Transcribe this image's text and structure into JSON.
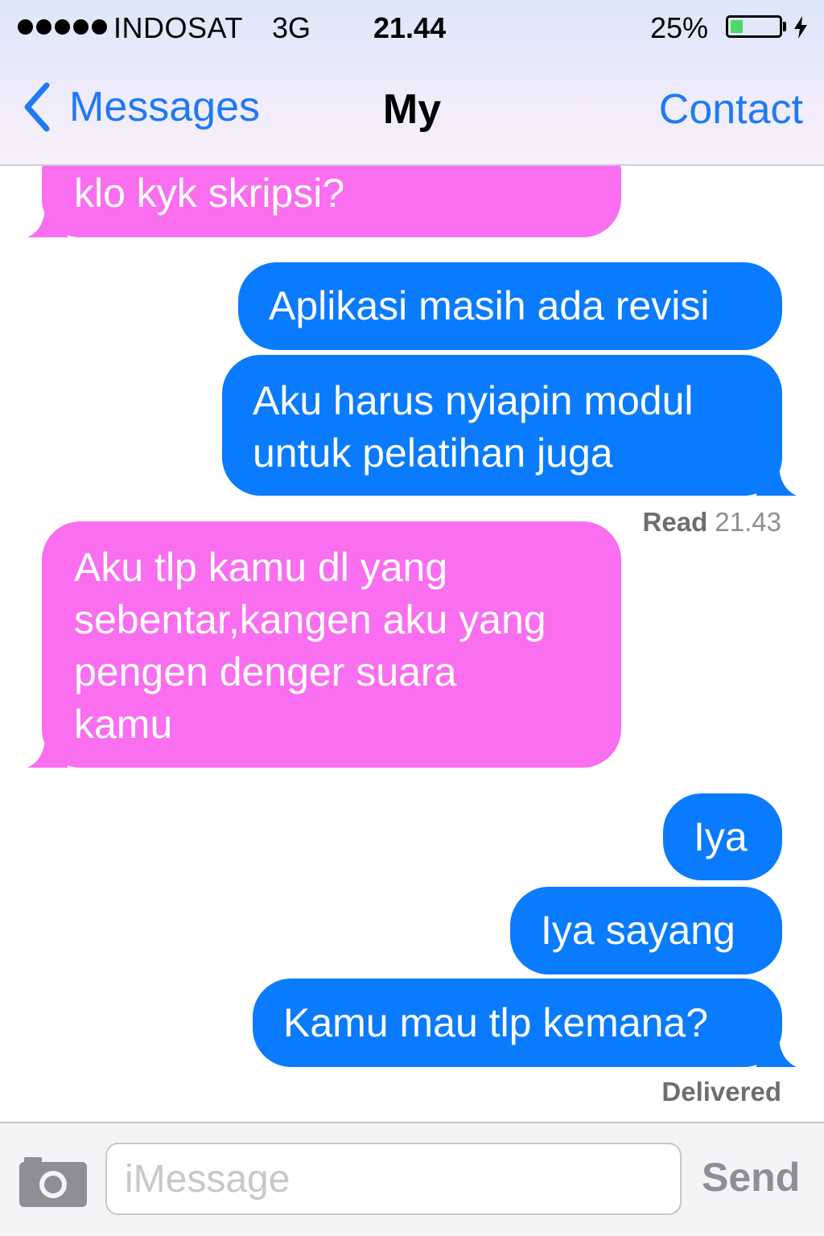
{
  "status_bar": {
    "carrier": "INDOSAT",
    "network": "3G",
    "time": "21.44",
    "battery_percent": "25%",
    "battery_level": 0.25,
    "battery_color": "#4cd964"
  },
  "nav": {
    "back_label": "Messages",
    "title": "My",
    "contact_label": "Contact"
  },
  "messages": [
    {
      "direction": "incoming",
      "text": "klo kyk skripsi?"
    },
    {
      "direction": "outgoing",
      "text": "Aplikasi masih ada revisi"
    },
    {
      "direction": "outgoing",
      "text": "Aku harus nyiapin modul\nuntuk pelatihan juga"
    },
    {
      "direction": "incoming",
      "text": "Aku tlp kamu dl yang\nsebentar,kangen aku yang\npengen denger suara\nkamu"
    },
    {
      "direction": "outgoing",
      "text": "Iya"
    },
    {
      "direction": "outgoing",
      "text": "Iya sayang"
    },
    {
      "direction": "outgoing",
      "text": "Kamu mau tlp kemana?"
    }
  ],
  "receipts": {
    "read_label": "Read",
    "read_time": "21.43",
    "delivered_label": "Delivered"
  },
  "input_bar": {
    "placeholder": "iMessage",
    "send_label": "Send"
  },
  "colors": {
    "incoming_bubble": "#f96ff0",
    "outgoing_bubble": "#0a7bfd",
    "accent": "#1e7af5"
  },
  "icons": [
    "signal-dots-icon",
    "battery-icon",
    "charging-bolt-icon",
    "chevron-left-icon",
    "camera-icon"
  ]
}
